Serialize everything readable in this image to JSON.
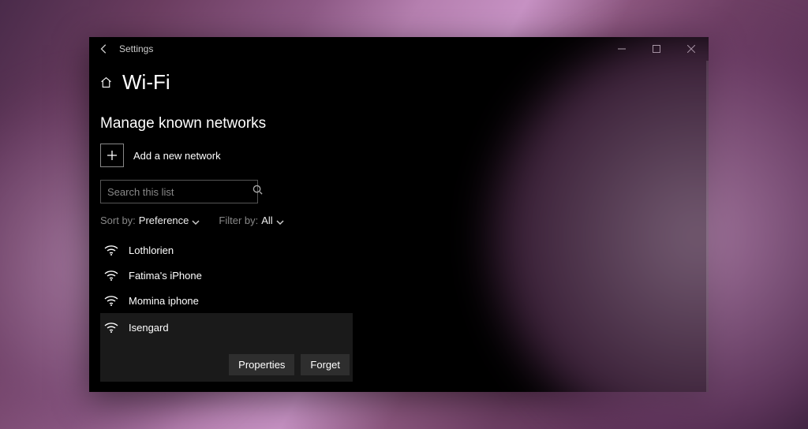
{
  "titlebar": {
    "appname": "Settings"
  },
  "header": {
    "title": "Wi-Fi"
  },
  "section": {
    "heading": "Manage known networks",
    "add_label": "Add a new network"
  },
  "search": {
    "placeholder": "Search this list"
  },
  "sort": {
    "label": "Sort by:",
    "value": "Preference"
  },
  "filter": {
    "label": "Filter by:",
    "value": "All"
  },
  "networks": {
    "0": {
      "name": "Lothlorien"
    },
    "1": {
      "name": "Fatima's iPhone"
    },
    "2": {
      "name": "Momina iphone"
    },
    "3": {
      "name": "Isengard"
    }
  },
  "buttons": {
    "properties": "Properties",
    "forget": "Forget"
  }
}
